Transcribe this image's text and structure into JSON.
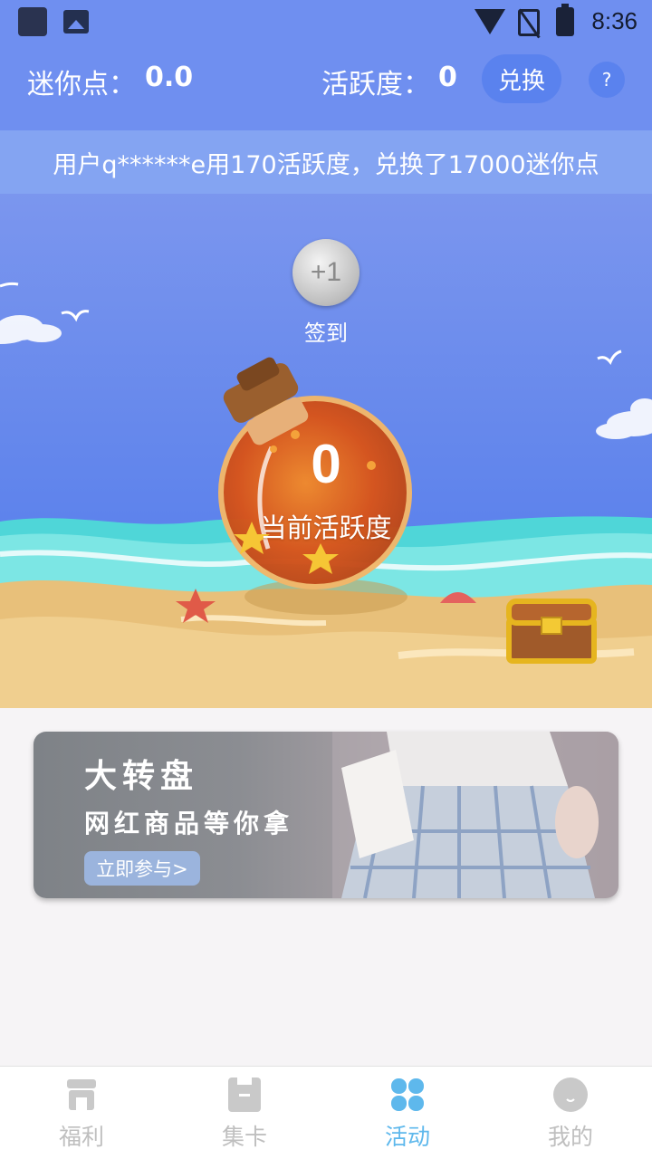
{
  "status_bar": {
    "time": "8:36",
    "icons": [
      "app-icon",
      "image-icon",
      "wifi-icon",
      "no-sim-icon",
      "battery-icon"
    ]
  },
  "header": {
    "mini_points_label": "迷你点：",
    "mini_points_value": "0.0",
    "activity_label": "活跃度：",
    "activity_value": "0",
    "exchange_button": "兑换",
    "help_button": "?"
  },
  "notice": {
    "text": "用户q******e用170活跃度，兑换了17000迷你点"
  },
  "scene": {
    "checkin_badge": "+1",
    "checkin_label": "签到",
    "bottle_value": "0",
    "bottle_label": "当前活跃度"
  },
  "banner": {
    "title": "大转盘",
    "subtitle": "网红商品等你拿",
    "button": "立即参与>"
  },
  "tabbar": {
    "tabs": [
      {
        "label": "福利",
        "icon": "shop-icon"
      },
      {
        "label": "集卡",
        "icon": "card-icon"
      },
      {
        "label": "活动",
        "icon": "clover-icon"
      },
      {
        "label": "我的",
        "icon": "profile-icon"
      }
    ],
    "active_index": 2
  },
  "colors": {
    "header_bg": "#6f8ff0",
    "notice_bg": "#84a4f2",
    "active_tab": "#5eb8ec",
    "inactive_tab": "#bfbfbf"
  }
}
